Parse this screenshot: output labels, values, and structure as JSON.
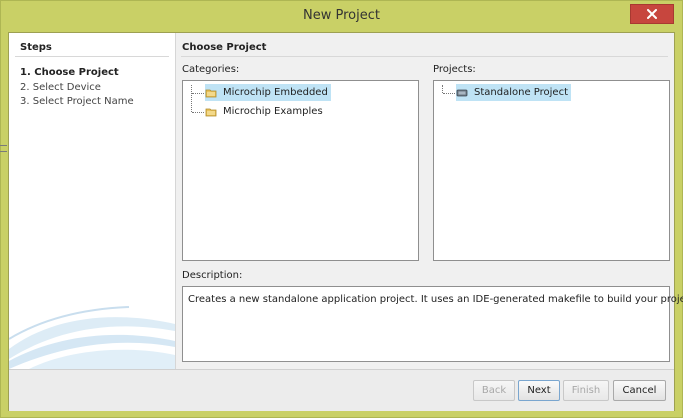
{
  "window": {
    "title": "New Project",
    "close_icon": "close-icon"
  },
  "steps": {
    "header": "Steps",
    "items": [
      {
        "label": "1. Choose Project",
        "active": true
      },
      {
        "label": "2. Select Device",
        "active": false
      },
      {
        "label": "3. Select Project Name",
        "active": false
      }
    ]
  },
  "main": {
    "header": "Choose Project",
    "categories_label": "Categories:",
    "projects_label": "Projects:",
    "description_label": "Description:",
    "categories": [
      {
        "label": "Microchip Embedded",
        "icon": "folder-icon",
        "selected": true
      },
      {
        "label": "Microchip Examples",
        "icon": "folder-icon",
        "selected": false
      }
    ],
    "projects": [
      {
        "label": "Standalone Project",
        "icon": "chip-icon",
        "selected": true
      }
    ],
    "description": "Creates a new standalone application project. It uses an IDE-generated makefile to build your project."
  },
  "footer": {
    "back_label": "Back",
    "next_label": "Next",
    "finish_label": "Finish",
    "cancel_label": "Cancel"
  },
  "colors": {
    "title_bar": "#c9d066",
    "close_button": "#c7463e",
    "selection": "#bfe3f5"
  }
}
